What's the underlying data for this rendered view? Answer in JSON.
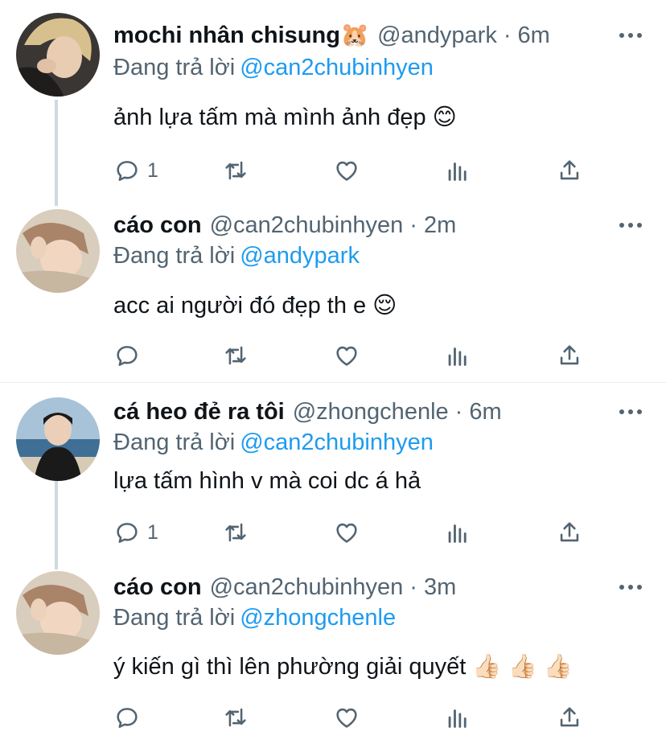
{
  "tweets": [
    {
      "display_name": "mochi nhân chisung",
      "name_emoji": "🐹",
      "handle": "@andypark",
      "separator": "·",
      "time": "6m",
      "reply_label": "Đang trả lời",
      "reply_to": "@can2chubinhyen",
      "text": "ảnh lựa tấm mà mình ảnh đẹp 😊",
      "reply_count": "1",
      "avatar": "blonde-person-avatar"
    },
    {
      "display_name": "cáo con",
      "name_emoji": "",
      "handle": "@can2chubinhyen",
      "separator": "·",
      "time": "2m",
      "reply_label": "Đang trả lời",
      "reply_to": "@andypark",
      "text": "acc ai người đó đẹp th e 😌",
      "reply_count": "",
      "avatar": "lying-person-avatar"
    },
    {
      "display_name": "cá heo đẻ ra tôi",
      "name_emoji": "",
      "handle": "@zhongchenle",
      "separator": "·",
      "time": "6m",
      "reply_label": "Đang trả lời",
      "reply_to": "@can2chubinhyen",
      "text": "lựa tấm hình v mà coi dc á hả",
      "reply_count": "1",
      "avatar": "beach-person-avatar"
    },
    {
      "display_name": "cáo con",
      "name_emoji": "",
      "handle": "@can2chubinhyen",
      "separator": "·",
      "time": "3m",
      "reply_label": "Đang trả lời",
      "reply_to": "@zhongchenle",
      "text": "ý kiến gì thì lên phường giải quyết 👍🏻 👍🏻 👍🏻",
      "reply_count": "",
      "avatar": "lying-person-avatar"
    }
  ],
  "icons": [
    "more-icon",
    "reply-icon",
    "retweet-icon",
    "like-icon",
    "views-icon",
    "share-icon"
  ],
  "colors": {
    "link": "#1d9bf0",
    "secondary": "#536471",
    "thread_line": "#cfd9de",
    "divider": "#e6ecf0"
  }
}
